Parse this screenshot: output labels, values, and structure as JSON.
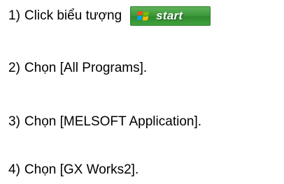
{
  "steps": [
    {
      "number": "1)",
      "text": "Click biểu tượng"
    },
    {
      "number": "2)",
      "text": "Chọn [All Programs]."
    },
    {
      "number": "3)",
      "text": "Chọn [MELSOFT Application]."
    },
    {
      "number": "4)",
      "text": "Chọn [GX Works2]."
    }
  ],
  "start_button": {
    "label": "start",
    "icon": "windows-logo-icon",
    "color": "#3d9a3a"
  }
}
